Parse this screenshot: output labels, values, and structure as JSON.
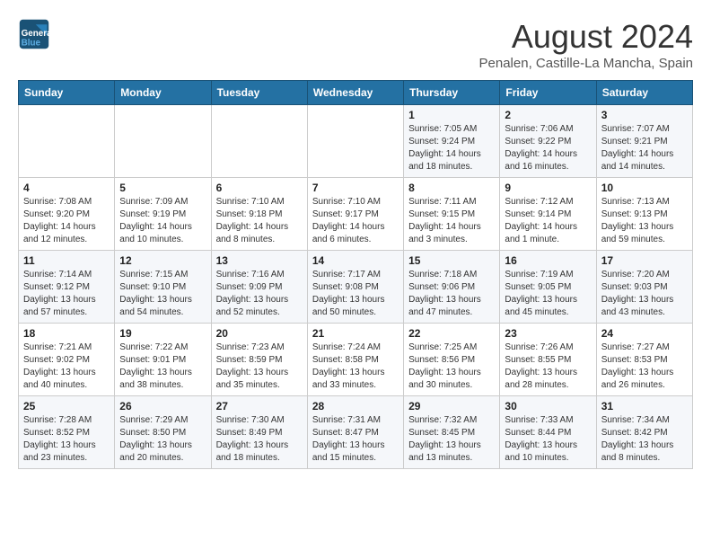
{
  "header": {
    "logo_line1": "General",
    "logo_line2": "Blue",
    "month": "August 2024",
    "location": "Penalen, Castille-La Mancha, Spain"
  },
  "weekdays": [
    "Sunday",
    "Monday",
    "Tuesday",
    "Wednesday",
    "Thursday",
    "Friday",
    "Saturday"
  ],
  "weeks": [
    [
      {
        "day": "",
        "info": ""
      },
      {
        "day": "",
        "info": ""
      },
      {
        "day": "",
        "info": ""
      },
      {
        "day": "",
        "info": ""
      },
      {
        "day": "1",
        "info": "Sunrise: 7:05 AM\nSunset: 9:24 PM\nDaylight: 14 hours and 18 minutes."
      },
      {
        "day": "2",
        "info": "Sunrise: 7:06 AM\nSunset: 9:22 PM\nDaylight: 14 hours and 16 minutes."
      },
      {
        "day": "3",
        "info": "Sunrise: 7:07 AM\nSunset: 9:21 PM\nDaylight: 14 hours and 14 minutes."
      }
    ],
    [
      {
        "day": "4",
        "info": "Sunrise: 7:08 AM\nSunset: 9:20 PM\nDaylight: 14 hours and 12 minutes."
      },
      {
        "day": "5",
        "info": "Sunrise: 7:09 AM\nSunset: 9:19 PM\nDaylight: 14 hours and 10 minutes."
      },
      {
        "day": "6",
        "info": "Sunrise: 7:10 AM\nSunset: 9:18 PM\nDaylight: 14 hours and 8 minutes."
      },
      {
        "day": "7",
        "info": "Sunrise: 7:10 AM\nSunset: 9:17 PM\nDaylight: 14 hours and 6 minutes."
      },
      {
        "day": "8",
        "info": "Sunrise: 7:11 AM\nSunset: 9:15 PM\nDaylight: 14 hours and 3 minutes."
      },
      {
        "day": "9",
        "info": "Sunrise: 7:12 AM\nSunset: 9:14 PM\nDaylight: 14 hours and 1 minute."
      },
      {
        "day": "10",
        "info": "Sunrise: 7:13 AM\nSunset: 9:13 PM\nDaylight: 13 hours and 59 minutes."
      }
    ],
    [
      {
        "day": "11",
        "info": "Sunrise: 7:14 AM\nSunset: 9:12 PM\nDaylight: 13 hours and 57 minutes."
      },
      {
        "day": "12",
        "info": "Sunrise: 7:15 AM\nSunset: 9:10 PM\nDaylight: 13 hours and 54 minutes."
      },
      {
        "day": "13",
        "info": "Sunrise: 7:16 AM\nSunset: 9:09 PM\nDaylight: 13 hours and 52 minutes."
      },
      {
        "day": "14",
        "info": "Sunrise: 7:17 AM\nSunset: 9:08 PM\nDaylight: 13 hours and 50 minutes."
      },
      {
        "day": "15",
        "info": "Sunrise: 7:18 AM\nSunset: 9:06 PM\nDaylight: 13 hours and 47 minutes."
      },
      {
        "day": "16",
        "info": "Sunrise: 7:19 AM\nSunset: 9:05 PM\nDaylight: 13 hours and 45 minutes."
      },
      {
        "day": "17",
        "info": "Sunrise: 7:20 AM\nSunset: 9:03 PM\nDaylight: 13 hours and 43 minutes."
      }
    ],
    [
      {
        "day": "18",
        "info": "Sunrise: 7:21 AM\nSunset: 9:02 PM\nDaylight: 13 hours and 40 minutes."
      },
      {
        "day": "19",
        "info": "Sunrise: 7:22 AM\nSunset: 9:01 PM\nDaylight: 13 hours and 38 minutes."
      },
      {
        "day": "20",
        "info": "Sunrise: 7:23 AM\nSunset: 8:59 PM\nDaylight: 13 hours and 35 minutes."
      },
      {
        "day": "21",
        "info": "Sunrise: 7:24 AM\nSunset: 8:58 PM\nDaylight: 13 hours and 33 minutes."
      },
      {
        "day": "22",
        "info": "Sunrise: 7:25 AM\nSunset: 8:56 PM\nDaylight: 13 hours and 30 minutes."
      },
      {
        "day": "23",
        "info": "Sunrise: 7:26 AM\nSunset: 8:55 PM\nDaylight: 13 hours and 28 minutes."
      },
      {
        "day": "24",
        "info": "Sunrise: 7:27 AM\nSunset: 8:53 PM\nDaylight: 13 hours and 26 minutes."
      }
    ],
    [
      {
        "day": "25",
        "info": "Sunrise: 7:28 AM\nSunset: 8:52 PM\nDaylight: 13 hours and 23 minutes."
      },
      {
        "day": "26",
        "info": "Sunrise: 7:29 AM\nSunset: 8:50 PM\nDaylight: 13 hours and 20 minutes."
      },
      {
        "day": "27",
        "info": "Sunrise: 7:30 AM\nSunset: 8:49 PM\nDaylight: 13 hours and 18 minutes."
      },
      {
        "day": "28",
        "info": "Sunrise: 7:31 AM\nSunset: 8:47 PM\nDaylight: 13 hours and 15 minutes."
      },
      {
        "day": "29",
        "info": "Sunrise: 7:32 AM\nSunset: 8:45 PM\nDaylight: 13 hours and 13 minutes."
      },
      {
        "day": "30",
        "info": "Sunrise: 7:33 AM\nSunset: 8:44 PM\nDaylight: 13 hours and 10 minutes."
      },
      {
        "day": "31",
        "info": "Sunrise: 7:34 AM\nSunset: 8:42 PM\nDaylight: 13 hours and 8 minutes."
      }
    ]
  ]
}
